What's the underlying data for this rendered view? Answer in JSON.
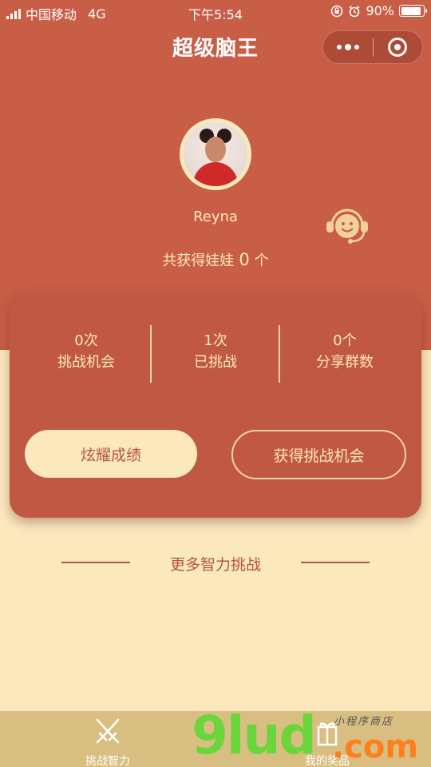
{
  "status_bar": {
    "carrier": "中国移动",
    "network": "4G",
    "time": "下午5:54",
    "battery": "90%",
    "battery_level": 0.9
  },
  "nav": {
    "title": "超级脑王"
  },
  "profile": {
    "username": "Reyna",
    "dolls_prefix": "共获得娃娃",
    "dolls_count": "0",
    "dolls_suffix": "个"
  },
  "stats": [
    {
      "value": "0次",
      "label": "挑战机会"
    },
    {
      "value": "1次",
      "label": "已挑战"
    },
    {
      "value": "0个",
      "label": "分享群数"
    }
  ],
  "buttons": {
    "show_off": "炫耀成绩",
    "get_chance": "获得挑战机会"
  },
  "more_section": {
    "title": "更多智力挑战"
  },
  "tabbar": {
    "tabs": [
      {
        "label": "挑战智力"
      },
      {
        "label": "我的奖品"
      }
    ]
  },
  "watermark": {
    "brand": "9lud",
    "domain": ".com",
    "tagline": "小程序商店"
  },
  "colors": {
    "primary_red": "#c95e47",
    "card_red": "#c05843",
    "cream": "#fbe8bd",
    "tabbar": "#d9be82"
  }
}
